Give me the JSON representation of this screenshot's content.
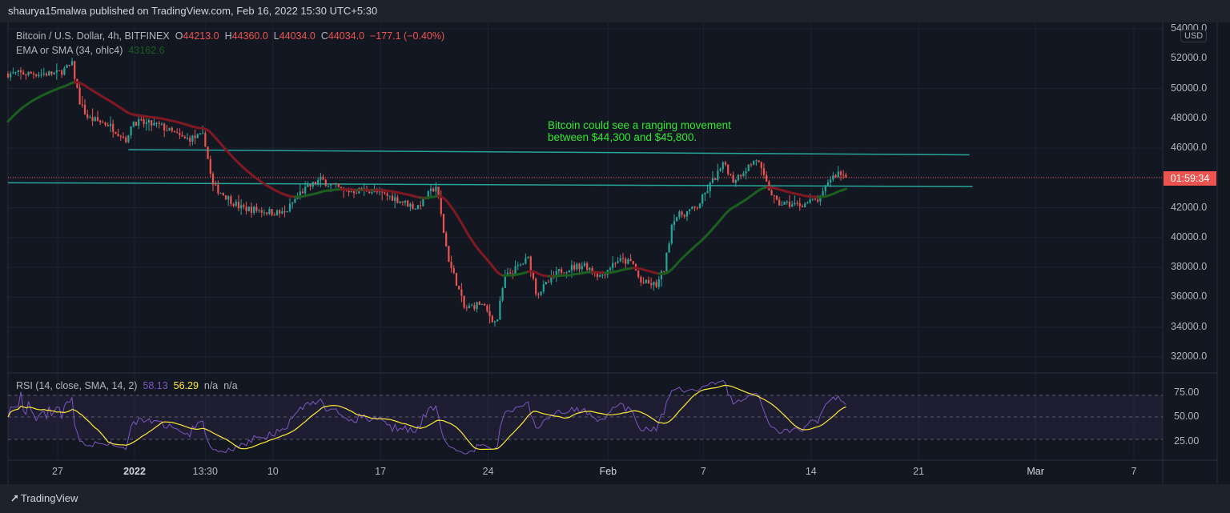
{
  "header": {
    "published": "shaurya15malwa published on TradingView.com, Feb 16, 2022 15:30 UTC+5:30"
  },
  "legend": {
    "symbol": "Bitcoin / U.S. Dollar, 4h, BITFINEX",
    "o_label": "O",
    "o": "44213.0",
    "h_label": "H",
    "h": "44360.0",
    "l_label": "L",
    "l": "44034.0",
    "c_label": "C",
    "c": "44034.0",
    "change": "−177.1 (−0.40%)",
    "ma_label": "EMA or SMA (34, ohlc4)",
    "ma_value": "43162.6",
    "rsi_label": "RSI (14, close, SMA, 14, 2)",
    "rsi_value": "58.13",
    "rsi_ma_value": "56.29",
    "na1": "n/a",
    "na2": "n/a"
  },
  "annotation": {
    "line1": "Bitcoin could see a ranging movement",
    "line2": "between $44,300 and $45,800."
  },
  "price_axis": {
    "currency": "USD",
    "labels": [
      "54000.0",
      "52000.0",
      "50000.0",
      "48000.0",
      "46000.0",
      "42000.0",
      "40000.0",
      "38000.0",
      "36000.0",
      "34000.0",
      "32000.0"
    ],
    "countdown": "01:59:34"
  },
  "rsi_axis": {
    "labels": [
      "75.00",
      "50.00",
      "25.00"
    ]
  },
  "time_axis": {
    "labels": [
      {
        "t": 0,
        "text": "27"
      },
      {
        "t": 5,
        "text": "2022"
      },
      {
        "t": 9.6,
        "text": "13:30"
      },
      {
        "t": 14,
        "text": "10"
      },
      {
        "t": 21,
        "text": "17"
      },
      {
        "t": 28,
        "text": "24"
      },
      {
        "t": 35.8,
        "text": "Feb"
      },
      {
        "t": 42,
        "text": "7"
      },
      {
        "t": 49,
        "text": "14"
      },
      {
        "t": 56,
        "text": "21"
      },
      {
        "t": 63.6,
        "text": "Mar"
      },
      {
        "t": 70,
        "text": "7"
      }
    ]
  },
  "footer": {
    "brand": "TradingView"
  },
  "colors": {
    "up": "#26a69a",
    "down": "#ef5350",
    "ma_up": "#1b5e20",
    "ma_down": "#801922",
    "rsi": "#7e57c2",
    "rsi_ma": "#ffeb3b",
    "lines": "#26a69a",
    "note": "#2ee82e"
  },
  "chart_data": {
    "type": "candlestick",
    "title": "Bitcoin / U.S. Dollar, 4h, BITFINEX",
    "x_unit": "days since Dec 27 2021",
    "ylim": [
      31000,
      54500
    ],
    "price_path": [
      [
        -3.23,
        51000
      ],
      [
        0,
        51000
      ],
      [
        0.94,
        51600
      ],
      [
        1.46,
        49000
      ],
      [
        1.98,
        48000
      ],
      [
        3.28,
        47600
      ],
      [
        4.58,
        46500
      ],
      [
        4.8,
        47800
      ],
      [
        6.67,
        47500
      ],
      [
        8.23,
        46600
      ],
      [
        9.53,
        46800
      ],
      [
        10.05,
        43500
      ],
      [
        11.88,
        42000
      ],
      [
        14.74,
        41600
      ],
      [
        15.78,
        43000
      ],
      [
        17.08,
        43900
      ],
      [
        18.65,
        43100
      ],
      [
        20.2,
        43200
      ],
      [
        21.77,
        42700
      ],
      [
        23.33,
        42000
      ],
      [
        24.64,
        43500
      ],
      [
        25.16,
        40000
      ],
      [
        25.5,
        38200
      ],
      [
        25.94,
        37000
      ],
      [
        26.46,
        35200
      ],
      [
        27.5,
        35600
      ],
      [
        28.54,
        34200
      ],
      [
        29.06,
        37300
      ],
      [
        30.63,
        38600
      ],
      [
        31.15,
        36200
      ],
      [
        32.7,
        37800
      ],
      [
        34.27,
        38200
      ],
      [
        35.3,
        37400
      ],
      [
        36.35,
        38500
      ],
      [
        37.4,
        38300
      ],
      [
        37.9,
        37000
      ],
      [
        38.96,
        36800
      ],
      [
        39.48,
        38000
      ],
      [
        40,
        41300
      ],
      [
        41.56,
        42000
      ],
      [
        42.6,
        43800
      ],
      [
        43.4,
        45000
      ],
      [
        43.9,
        43800
      ],
      [
        45.47,
        45300
      ],
      [
        46,
        43800
      ],
      [
        46.77,
        42300
      ],
      [
        48.33,
        42200
      ],
      [
        49.64,
        42600
      ],
      [
        50.16,
        43900
      ],
      [
        50.83,
        44400
      ],
      [
        51.25,
        44034
      ]
    ],
    "last_candle": {
      "open": 44213.0,
      "high": 44360.0,
      "low": 44034.0,
      "close": 44034.0
    },
    "ma": {
      "name": "EMA or SMA (34, ohlc4)",
      "last": 43162.6
    },
    "rsi": {
      "name": "RSI (14, close, SMA, 14, 2)",
      "last": 58.13,
      "ma_last": 56.29,
      "bands": [
        70,
        50,
        30
      ]
    },
    "horizontal_lines": [
      {
        "t1": 4.6,
        "p1": 45900,
        "t2": 59.3,
        "p2": 45550
      },
      {
        "t1": -3.23,
        "p1": 43680,
        "t2": 59.5,
        "p2": 43420
      }
    ],
    "current_price": 44034.0
  }
}
